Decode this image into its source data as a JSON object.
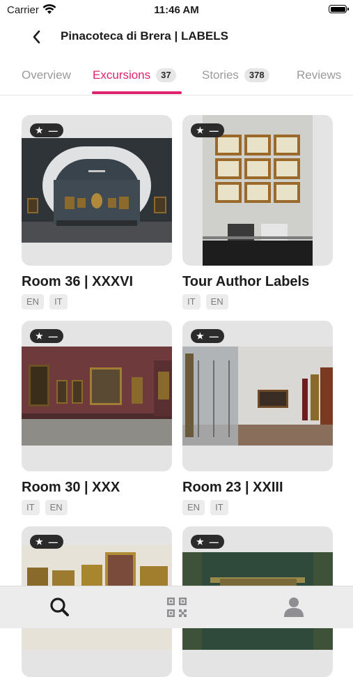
{
  "status": {
    "carrier": "Carrier",
    "time": "11:46 AM"
  },
  "header": {
    "title": "Pinacoteca di Brera | LABELS"
  },
  "tabs": [
    {
      "label": "Overview",
      "badge": ""
    },
    {
      "label": "Excursions",
      "badge": "37",
      "active": true
    },
    {
      "label": "Stories",
      "badge": "378"
    },
    {
      "label": "Reviews",
      "badge": ""
    }
  ],
  "accent_color": "#e0226e",
  "cards": [
    {
      "title": "Room 36 | XXXVI",
      "rating": "—",
      "languages": [
        "EN",
        "IT"
      ]
    },
    {
      "title": "Tour Author Labels",
      "rating": "—",
      "languages": [
        "IT",
        "EN"
      ]
    },
    {
      "title": "Room 30 | XXX",
      "rating": "—",
      "languages": [
        "IT",
        "EN"
      ]
    },
    {
      "title": "Room 23 | XXIII",
      "rating": "—",
      "languages": [
        "EN",
        "IT"
      ]
    },
    {
      "title": "",
      "rating": "—",
      "languages": []
    },
    {
      "title": "",
      "rating": "—",
      "languages": []
    }
  ],
  "bottom_tabs": [
    {
      "icon": "search-icon",
      "active": true
    },
    {
      "icon": "qr-code-icon",
      "active": false
    },
    {
      "icon": "profile-icon",
      "active": false
    }
  ]
}
